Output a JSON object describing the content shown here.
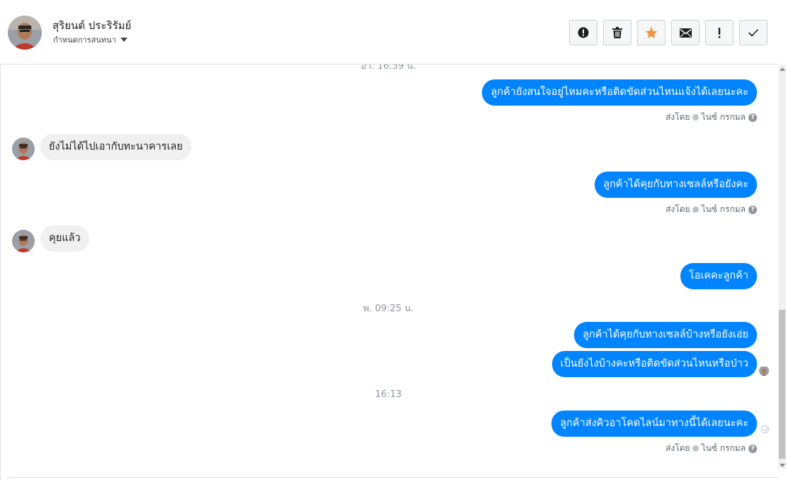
{
  "header": {
    "contact_name": "สุริยนต์ ประริรัมย์",
    "assign_label": "กำหนดการสนทนา",
    "toolbar": [
      {
        "icon": "alert-circle-icon",
        "name": "mark-spam-button"
      },
      {
        "icon": "trash-icon",
        "name": "delete-button"
      },
      {
        "icon": "star-icon",
        "name": "star-button",
        "color": "#f7923a"
      },
      {
        "icon": "envelope-icon",
        "name": "mark-unread-button"
      },
      {
        "icon": "exclamation-icon",
        "name": "follow-up-button"
      },
      {
        "icon": "checkmark-icon",
        "name": "mark-done-button"
      }
    ]
  },
  "colors": {
    "outgoing_bubble": "#0084ff",
    "incoming_bubble": "#f1f0f0",
    "star": "#f7923a"
  },
  "chat": {
    "top_timestamp_partial": "อา. 16:59 น.",
    "messages": [
      {
        "dir": "out",
        "text": "ลูกค้ายังสนใจอยู่ไหมคะหรือติดขัดส่วนไหนแจ้งได้เลยนะคะ"
      },
      {
        "sent_by_label": "ส่งโดย",
        "sender": "ไนซ์ กรกมล"
      },
      {
        "dir": "in",
        "text": "ยังไม่ได้ไปเอากับทะนาคารเลย"
      },
      {
        "dir": "out",
        "text": "ลูกค้าได้คุยกับทางเซลล์หรือยังคะ"
      },
      {
        "sent_by_label": "ส่งโดย",
        "sender": "ไนซ์ กรกมล"
      },
      {
        "dir": "in",
        "text": "คุยแล้ว"
      },
      {
        "dir": "out",
        "text": "โอเคคะลูกค้า"
      },
      {
        "timestamp": "พ. 09:25 น."
      },
      {
        "dir": "out",
        "text": "ลูกค้าได้คุยกับทางเซลล์บ้างหรือยังเอ่ย"
      },
      {
        "dir": "out",
        "text": "เป็นยังไงบ้างคะหรือติดขัดส่วนไหนหรือป่าว"
      },
      {
        "timestamp": "16:13"
      },
      {
        "dir": "out",
        "text": "ลูกค้าส่งคิวอาโคดไลน์มาทางนี้ได้เลยนะคะ"
      },
      {
        "sent_by_label": "ส่งโดย",
        "sender": "ไนซ์ กรกมล"
      }
    ]
  }
}
